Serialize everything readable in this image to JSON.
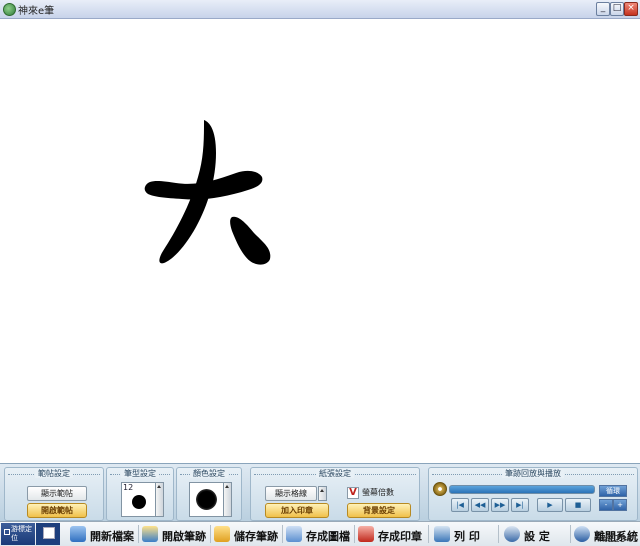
{
  "window": {
    "title": "神來e筆",
    "buttons": {
      "minimize": "_",
      "maximize": "□",
      "close": "×"
    }
  },
  "canvas": {
    "glyph": "大"
  },
  "panels": {
    "copybook": {
      "title": "範帖設定",
      "show_label": "顯示範帖",
      "open_label": "開啟範帖"
    },
    "brush": {
      "title": "筆型設定",
      "size": "12"
    },
    "color": {
      "title": "顏色設定"
    },
    "paper": {
      "title": "紙張設定",
      "grid_label": "顯示格線",
      "seal_label": "加入印章",
      "zoom_label": "螢幕倍數",
      "zoom_checked": "V",
      "bg_label": "背景設定"
    },
    "player": {
      "title": "筆跡回放與播放",
      "buttons": [
        "|◀",
        "◀◀",
        "▶▶",
        "▶|",
        "▶",
        "■"
      ],
      "loop": "循環"
    }
  },
  "toolbar": {
    "cursor_label": "游標定位",
    "items": [
      {
        "label": "開新檔案",
        "icon": "new-file-icon",
        "color": "#2f6fc0"
      },
      {
        "label": "開啟筆跡",
        "icon": "open-folder-icon",
        "color": "#3b7ec8"
      },
      {
        "label": "儲存筆跡",
        "icon": "save-brush-icon",
        "color": "#e0a020"
      },
      {
        "label": "存成圖檔",
        "icon": "save-image-icon",
        "color": "#5b8fd0"
      },
      {
        "label": "存成印章",
        "icon": "save-seal-icon",
        "color": "#c0281c"
      },
      {
        "label": "列 印",
        "icon": "printer-icon",
        "color": "#3a76b8"
      },
      {
        "label": "設 定",
        "icon": "settings-icon",
        "color": "#3a6aa8"
      },
      {
        "label": "離開系統",
        "icon": "exit-icon",
        "color": "#2a5ea2"
      }
    ],
    "tag": "#22941"
  },
  "colors": {
    "ink": "#000000",
    "accent": "#f0c04a",
    "panel": "#c9dbe8",
    "title_blue": "#2a72b8"
  }
}
